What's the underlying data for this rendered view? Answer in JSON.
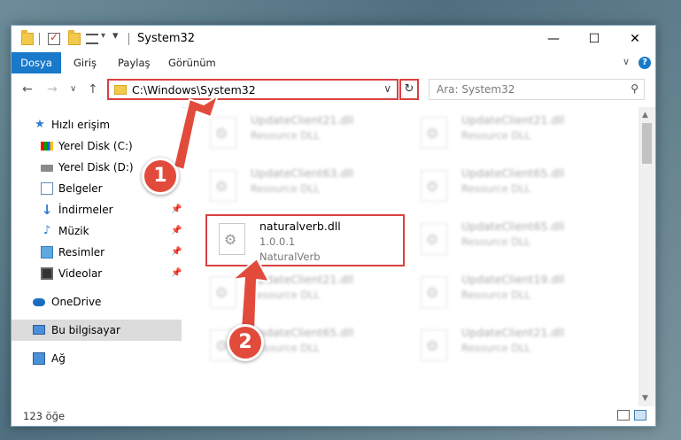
{
  "window": {
    "title": "System32",
    "minimize_glyph": "—",
    "maximize_glyph": "☐",
    "close_glyph": "✕",
    "qat_dropdown": "▾"
  },
  "ribbon": {
    "tabs": [
      "Dosya",
      "Giriş",
      "Paylaş",
      "Görünüm"
    ],
    "collapse_glyph": "∨",
    "help_glyph": "?"
  },
  "address": {
    "back": "←",
    "forward": "→",
    "recent": "∨",
    "up": "↑",
    "path": "C:\\Windows\\System32",
    "dropdown": "∨",
    "refresh": "↻",
    "search_placeholder": "Ara: System32",
    "search_icon": "⚲"
  },
  "nav": {
    "items": [
      {
        "label": "Hızlı erişim",
        "icon": "star-icon"
      },
      {
        "label": "Yerel Disk (C:)",
        "icon": "disk-c-icon"
      },
      {
        "label": "Yerel Disk (D:)",
        "icon": "disk-d-icon"
      },
      {
        "label": "Belgeler",
        "icon": "documents-icon"
      },
      {
        "label": "İndirmeler",
        "icon": "downloads-icon",
        "pin": "📌"
      },
      {
        "label": "Müzik",
        "icon": "music-icon",
        "pin": "📌"
      },
      {
        "label": "Resimler",
        "icon": "pictures-icon",
        "pin": "📌"
      },
      {
        "label": "Videolar",
        "icon": "videos-icon",
        "pin": "📌"
      },
      {
        "label": "OneDrive",
        "icon": "onedrive-icon"
      },
      {
        "label": "Bu bilgisayar",
        "icon": "this-pc-icon"
      },
      {
        "label": "Ağ",
        "icon": "network-icon"
      }
    ]
  },
  "files": [
    {
      "name": "UpdateClient21.dll",
      "desc": "Resource DLL"
    },
    {
      "name": "UpdateClient21.dll",
      "desc": "Resource DLL"
    },
    {
      "name": "UpdateClient63.dll",
      "desc": "Resource DLL"
    },
    {
      "name": "UpdateClient65.dll",
      "desc": "Resource DLL"
    },
    {
      "name": "naturalverb.dll",
      "version": "1.0.0.1",
      "desc": "NaturalVerb"
    },
    {
      "name": "UpdateClient65.dll",
      "desc": "Resource DLL"
    },
    {
      "name": "UpdateClient21.dll",
      "desc": "Resource DLL"
    },
    {
      "name": "UpdateClient19.dll",
      "desc": "Resource DLL"
    },
    {
      "name": "UpdateClient65.dll",
      "desc": "Resource DLL"
    },
    {
      "name": "UpdateClient21.dll",
      "desc": "Resource DLL"
    }
  ],
  "scroll": {
    "up": "▲",
    "down": "▼"
  },
  "status": {
    "count": "123 öğe"
  },
  "annotations": {
    "step1": "1",
    "step2": "2",
    "color": "#e24b3b"
  }
}
